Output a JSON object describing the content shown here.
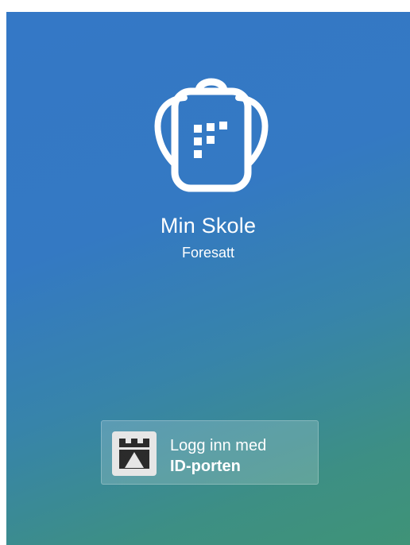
{
  "app": {
    "title": "Min Skole",
    "subtitle": "Foresatt"
  },
  "login": {
    "line1": "Logg inn med",
    "line2": "ID-porten",
    "icon": "id-porten-tower-icon"
  },
  "logo": {
    "icon": "school-backpack-icon"
  },
  "colors": {
    "gradient_top": "#3478c6",
    "gradient_bottom": "#3f9377",
    "text": "#ffffff"
  }
}
